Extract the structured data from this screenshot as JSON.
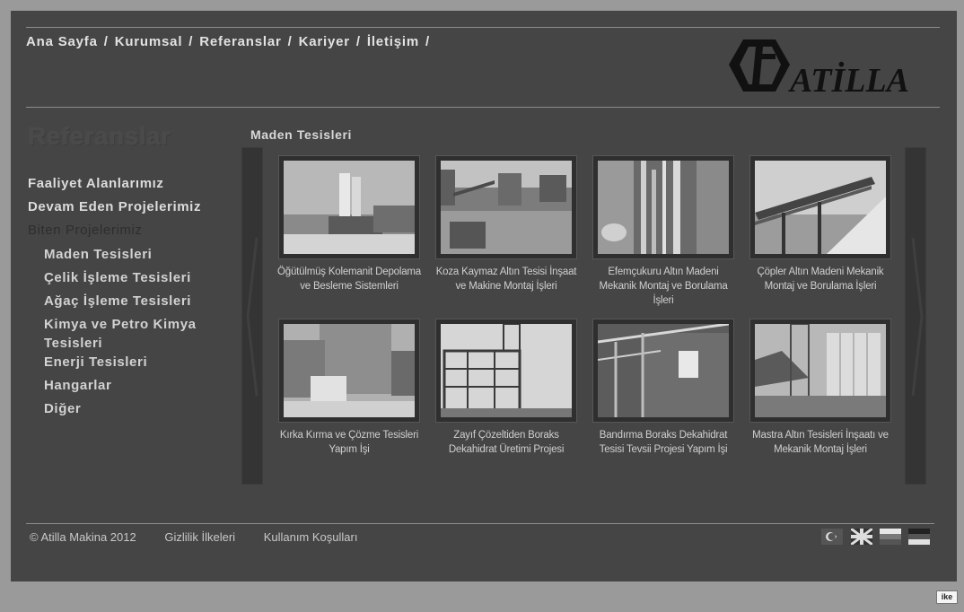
{
  "nav": {
    "items": [
      "Ana Sayfa",
      "Kurumsal",
      "Referanslar",
      "Kariyer",
      "İletişim"
    ],
    "separator": "/"
  },
  "brand": {
    "name": "ATİLLA"
  },
  "page": {
    "title": "Referanslar"
  },
  "sidebar": {
    "main": [
      "Faaliyet Alanlarımız",
      "Devam Eden Projelerimiz",
      "Biten Projelerimiz"
    ],
    "sub": [
      "Maden Tesisleri",
      "Çelik İşleme Tesisleri",
      "Ağaç İşleme Tesisleri",
      "Kimya ve Petro Kimya Tesisleri",
      "Enerji Tesisleri",
      "Hangarlar",
      "Diğer"
    ]
  },
  "section": {
    "title": "Maden Tesisleri"
  },
  "projects": [
    {
      "caption": "Öğütülmüş Kolemanit Depolama ve Besleme Sistemleri",
      "icon": "silo-plant-photo"
    },
    {
      "caption": "Koza Kaymaz Altın Tesisi İnşaat ve Makine Montaj İşleri",
      "icon": "gold-plant-photo"
    },
    {
      "caption": "Efemçukuru Altın Madeni Mekanik Montaj ve Borulama İşleri",
      "icon": "piping-photo"
    },
    {
      "caption": "Çöpler Altın Madeni Mekanik Montaj ve Borulama İşleri",
      "icon": "conveyor-photo"
    },
    {
      "caption": "Kırka Kırma ve Çözme Tesisleri Yapım İşi",
      "icon": "crushing-plant-photo"
    },
    {
      "caption": "Zayıf Çözeltiden Boraks Dekahidrat Üretimi Projesi",
      "icon": "steel-frame-photo"
    },
    {
      "caption": "Bandırma Boraks Dekahidrat Tesisi Tevsii Projesi Yapım İşi",
      "icon": "steel-structure-photo"
    },
    {
      "caption": "Mastra Altın Tesisleri İnşaatı ve Mekanik Montaj İşleri",
      "icon": "tower-building-photo"
    }
  ],
  "footer": {
    "copyright": "© Atilla Makina 2012",
    "privacy": "Gizlilik İlkeleri",
    "terms": "Kullanım Koşulları"
  },
  "languages": [
    "turkish-flag-icon",
    "english-flag-icon",
    "russian-flag-icon",
    "german-flag-icon"
  ],
  "badge": {
    "label": "ike"
  }
}
